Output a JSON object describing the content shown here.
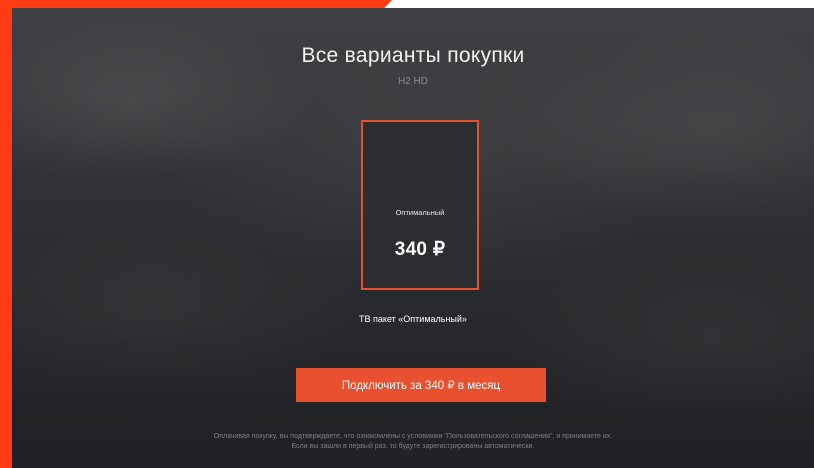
{
  "header": {
    "title": "Все варианты покупки",
    "subtitle": "H2 HD"
  },
  "offer_card": {
    "name": "Оптимальный",
    "price": "340 ₽",
    "selected": true
  },
  "package_label": "ТВ  пакет «Оптимальный»",
  "subscribe_button": {
    "label": "Подключить за 340 ₽ в месяц"
  },
  "disclaimer": {
    "line1": "Оплачивая покупку, вы подтверждаете, что ознакомлены с условиями \"Пользовательского соглашения\", и принимаете их.",
    "line2": "Если вы зашли в первый раз, то будуте зарегистрированы автоматически."
  },
  "colors": {
    "accent": "#e8502f",
    "frame": "#ff3c14",
    "background": "#2f3134"
  }
}
